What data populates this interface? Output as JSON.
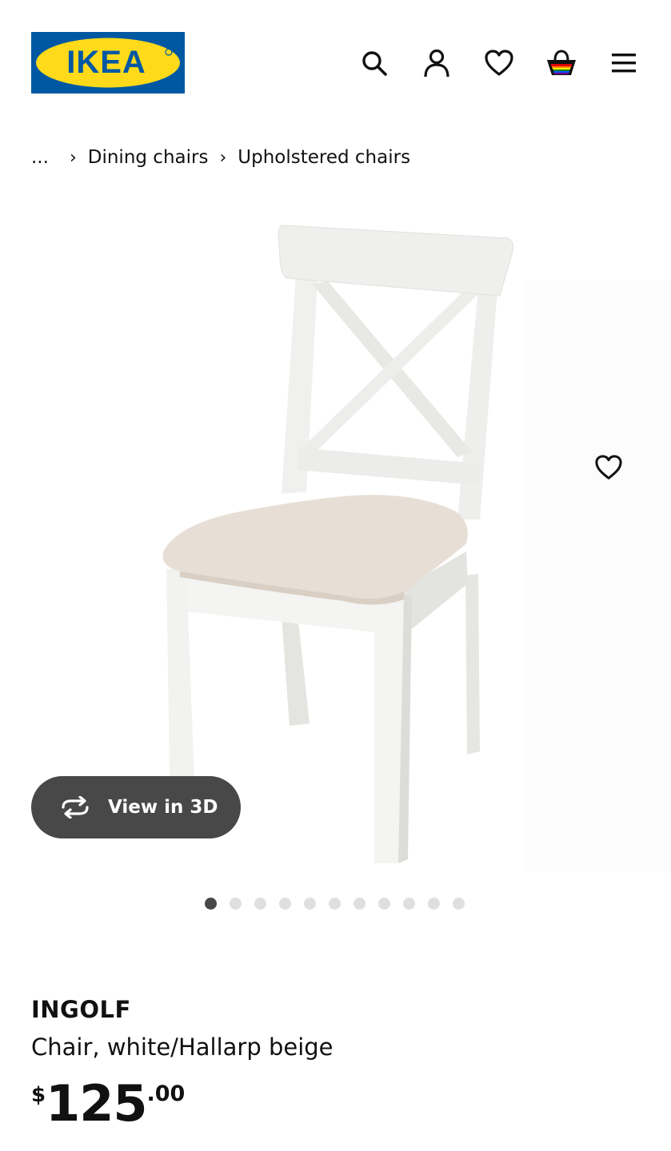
{
  "header": {
    "logo_text": "IKEA",
    "icons": [
      "search-icon",
      "account-icon",
      "favorites-icon",
      "cart-icon",
      "menu-icon"
    ]
  },
  "breadcrumb": {
    "items": [
      "...",
      "Dining chairs",
      "Upholstered chairs"
    ]
  },
  "gallery": {
    "view_3d_label": "View in 3D",
    "dot_count": 11,
    "active_index": 0
  },
  "product": {
    "name": "INGOLF",
    "description": "Chair, white/Hallarp beige",
    "price_currency": "$",
    "price_integer": "125",
    "price_decimal": ".00"
  },
  "colors": {
    "ikea_blue": "#0058a3",
    "ikea_yellow": "#ffda1a",
    "button_dark": "#484848",
    "dot_inactive": "#dfdfdf"
  }
}
